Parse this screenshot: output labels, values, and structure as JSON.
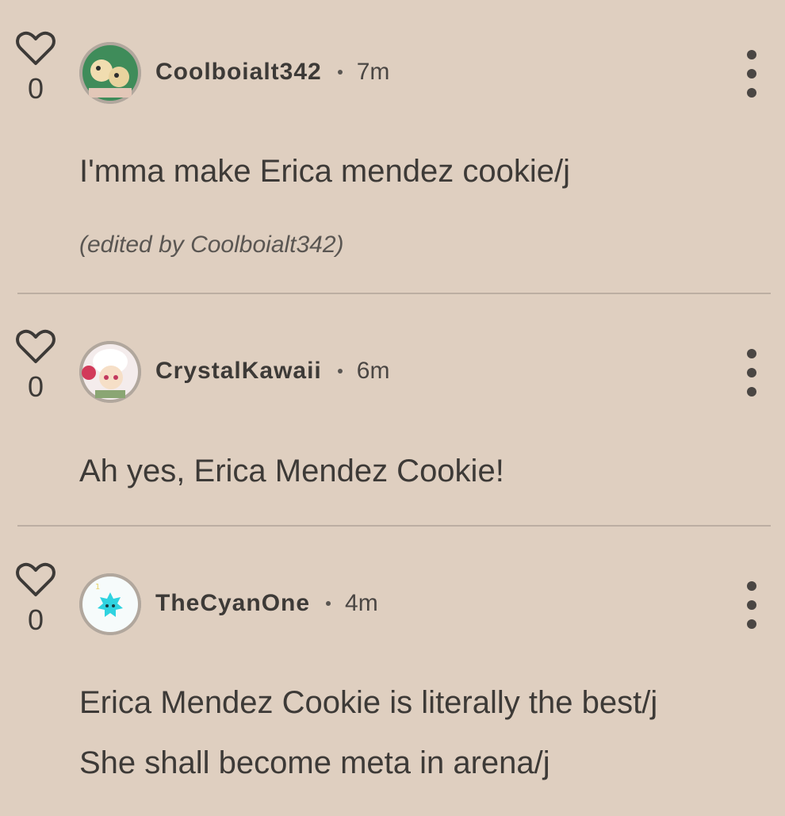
{
  "comments": [
    {
      "likes": "0",
      "username": "Coolboialt342",
      "time": "7m",
      "text": "I'mma make Erica mendez cookie/j",
      "edited": "(edited by Coolboialt342)"
    },
    {
      "likes": "0",
      "username": "CrystalKawaii",
      "time": "6m",
      "text": "Ah yes, Erica Mendez Cookie!"
    },
    {
      "likes": "0",
      "username": "TheCyanOne",
      "time": "4m",
      "text_lines": [
        "Erica Mendez Cookie is literally the best/j",
        "She shall become meta in arena/j"
      ]
    }
  ],
  "icons": {
    "like": "heart-icon",
    "menu": "more-vertical-icon"
  },
  "colors": {
    "background": "#dfcfc0",
    "text": "#3d3a37",
    "divider": "#bcaea2"
  }
}
